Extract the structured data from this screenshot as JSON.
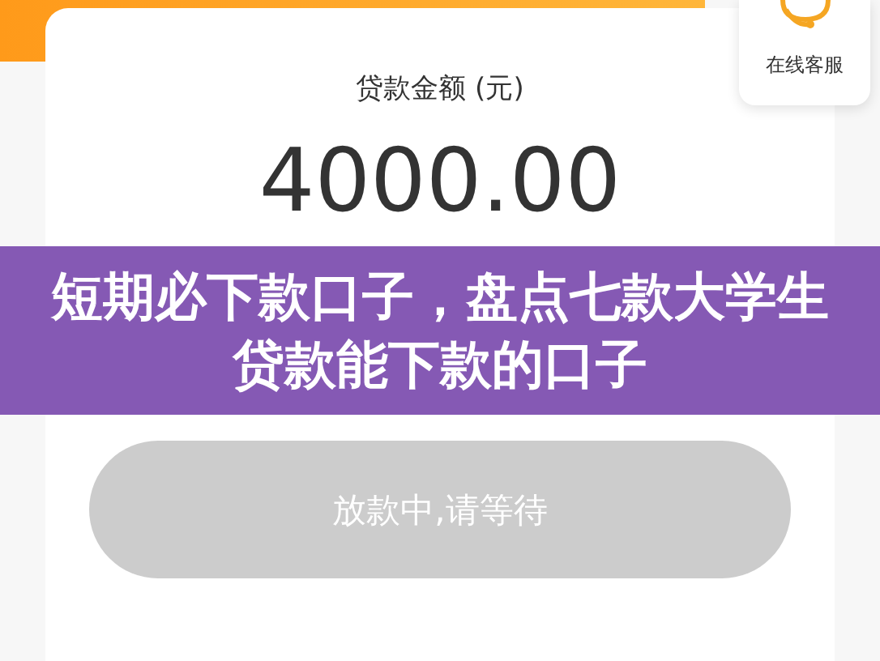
{
  "loan": {
    "label": "贷款金额 (元)",
    "amount": "4000.00"
  },
  "service": {
    "label": "在线客服"
  },
  "banner": {
    "title": "短期必下款口子，盘点七款大学生贷款能下款的口子"
  },
  "button": {
    "label": "放款中,请等待",
    "disabled": true
  }
}
